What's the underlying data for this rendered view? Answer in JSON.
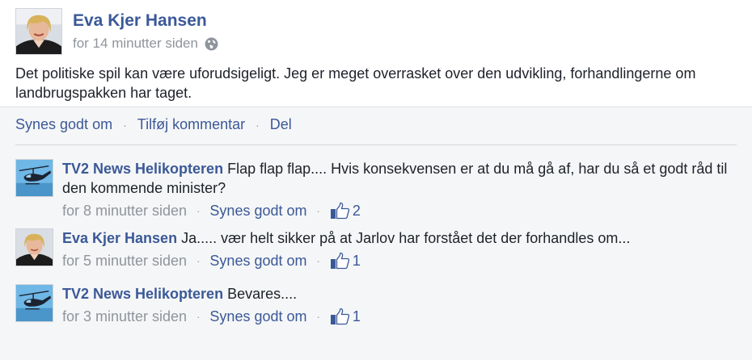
{
  "post": {
    "author": "Eva Kjer Hansen",
    "time": "for 14 minutter siden",
    "privacy_icon": "globe-icon",
    "text": "Det politiske spil kan være uforudsigeligt. Jeg er meget overrasket over den udvikling, forhandlingerne om landbrugspakken har taget."
  },
  "actions": {
    "like": "Synes godt om",
    "comment": "Tilføj kommentar",
    "share": "Del",
    "separator": "·"
  },
  "comments": [
    {
      "author": "TV2 News Helikopteren",
      "text": "Flap flap flap....  Hvis konsekvensen er at du må gå af, har du så et godt råd til den kommende minister?",
      "time": "for 8 minutter siden",
      "like_label": "Synes godt om",
      "likes": "2",
      "avatar": "helicopter"
    },
    {
      "author": "Eva Kjer Hansen",
      "text": "Ja..... vær helt sikker på at Jarlov har forstået det der forhandles om...",
      "time": "for 5 minutter siden",
      "like_label": "Synes godt om",
      "likes": "1",
      "avatar": "person"
    },
    {
      "author": "TV2 News Helikopteren",
      "text": "Bevares....",
      "time": "for 3 minutter siden",
      "like_label": "Synes godt om",
      "likes": "1",
      "avatar": "helicopter"
    }
  ],
  "colors": {
    "link": "#3b5998",
    "meta": "#90949c",
    "text": "#1d2129",
    "background": "#f5f6f7"
  }
}
